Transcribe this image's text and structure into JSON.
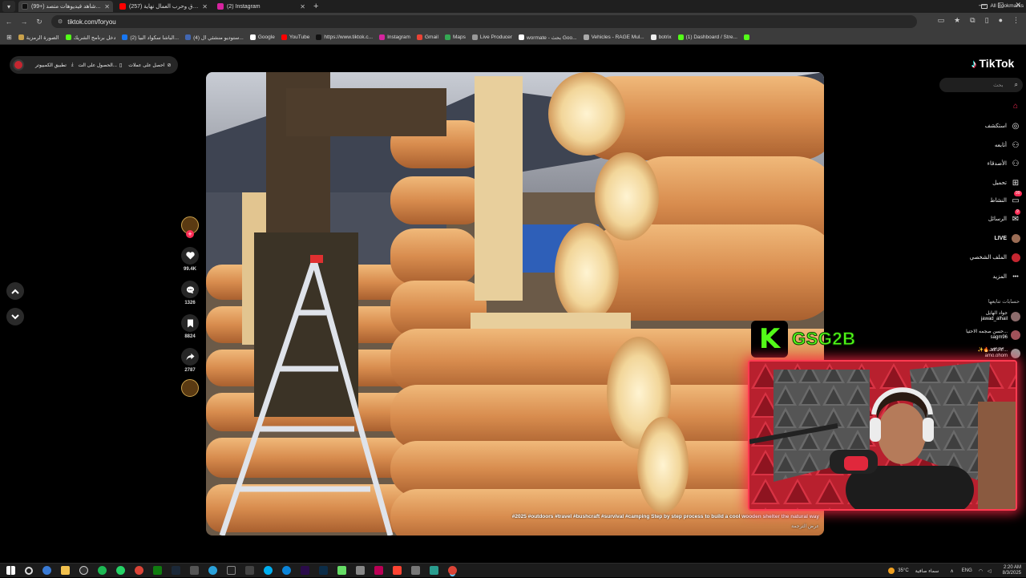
{
  "browser": {
    "tab_menu_icon": "chevron-down",
    "tabs": [
      {
        "title": "(99+) شاهد فيديوهات متصد...",
        "favicon": "tiktok",
        "color": "#111111",
        "active": true
      },
      {
        "title": "(257) العراق وحرب العمال نهاية",
        "favicon": "youtube",
        "color": "#ff0000",
        "active": false
      },
      {
        "title": "(2) Instagram",
        "favicon": "instagram",
        "color": "#d6249f",
        "active": false
      }
    ],
    "new_tab": "+",
    "address": "tiktok.com/foryou",
    "bookmarks": [
      {
        "label": "الصورة الرمزية",
        "color": "#c9a14b"
      },
      {
        "label": "دخل برنامج الشريك",
        "color": "#53fc18"
      },
      {
        "label": "(2) الباشا سكواد البيا...",
        "color": "#1877f2"
      },
      {
        "label": "(4) ستوديو منشئي ال...",
        "color": "#4267b2"
      },
      {
        "label": "Google",
        "color": "#ffffff"
      },
      {
        "label": "YouTube",
        "color": "#ff0000"
      },
      {
        "label": "https://www.tiktok.c...",
        "color": "#111111"
      },
      {
        "label": "Instagram",
        "color": "#d6249f"
      },
      {
        "label": "Gmail",
        "color": "#ea4335"
      },
      {
        "label": "Maps",
        "color": "#34a853"
      },
      {
        "label": "Live Producer",
        "color": "#999999"
      },
      {
        "label": "wormate - بحث Goo...",
        "color": "#ffffff"
      },
      {
        "label": "Vehicles - RAGE Mul...",
        "color": "#aaaaaa"
      },
      {
        "label": "botrix",
        "color": "#eeeeee"
      },
      {
        "label": "(1) Dashboard / Stre...",
        "color": "#53fc18"
      },
      {
        "label": "",
        "color": "#53fc18"
      }
    ],
    "all_bookmarks": "All Bookmarks"
  },
  "tiktok": {
    "logo": "TikTok",
    "search_placeholder": "بحث",
    "promo": {
      "get_coins": "احصل على عملات",
      "get_app": "الحصول على الت...",
      "desktop_app": "تطبيق الكمبيوتر"
    },
    "nav": [
      {
        "label": "",
        "icon": "home-icon",
        "glyph": "⌂",
        "active": true
      },
      {
        "label": "استكشف",
        "icon": "compass-icon",
        "glyph": "◎",
        "active": false
      },
      {
        "label": "أتابعه",
        "icon": "user-follow-icon",
        "glyph": "⚇",
        "active": false
      },
      {
        "label": "الأصدقاء",
        "icon": "friends-icon",
        "glyph": "⚇",
        "active": false
      },
      {
        "label": "تحميل",
        "icon": "upload-icon",
        "glyph": "⊞",
        "active": false
      },
      {
        "label": "النشاط",
        "icon": "activity-icon",
        "glyph": "▭",
        "badge": "99",
        "active": false
      },
      {
        "label": "الرسائل",
        "icon": "messages-icon",
        "glyph": "✉",
        "badge": "9",
        "active": false
      },
      {
        "label": "LIVE",
        "icon": "live-avatar-icon",
        "glyph": "●",
        "active": false
      },
      {
        "label": "الملف الشخصي",
        "icon": "profile-avatar-icon",
        "glyph": "●",
        "active": false
      },
      {
        "label": "المزيد",
        "icon": "more-icon",
        "glyph": "•••",
        "active": false
      }
    ],
    "following_title": "حسابات تتابعها",
    "following": [
      {
        "name": "جواد الهايل",
        "username": "jawad_alhail",
        "color": "#8b6b6b"
      },
      {
        "name": "حسن صجمه الاحتيا...",
        "username": "sagm96",
        "color": "#a0525a"
      },
      {
        "name": "✨🔥𝓗𝓞𝓢𝓞...",
        "username": "amo.ohom",
        "color": "#9a9a9a"
      }
    ],
    "video": {
      "caption": "#2025 #outdoors #travel #bushcraft #survival #camping Step by step process to build a cool wooden shelter the natural way",
      "translation": "عرض الترجمة"
    },
    "actions": {
      "likes": "99.4K",
      "comments": "1326",
      "saves": "8824",
      "shares": "2787"
    }
  },
  "overlay": {
    "brand": "GSG2B",
    "logo_letter": "K",
    "border_color": "#ff3a50",
    "brand_color": "#53fc18"
  },
  "taskbar": {
    "temperature": "35°C",
    "weather": "سماء صافية",
    "lang": "ENG",
    "time": "2:20 AM",
    "date": "8/3/2025"
  }
}
